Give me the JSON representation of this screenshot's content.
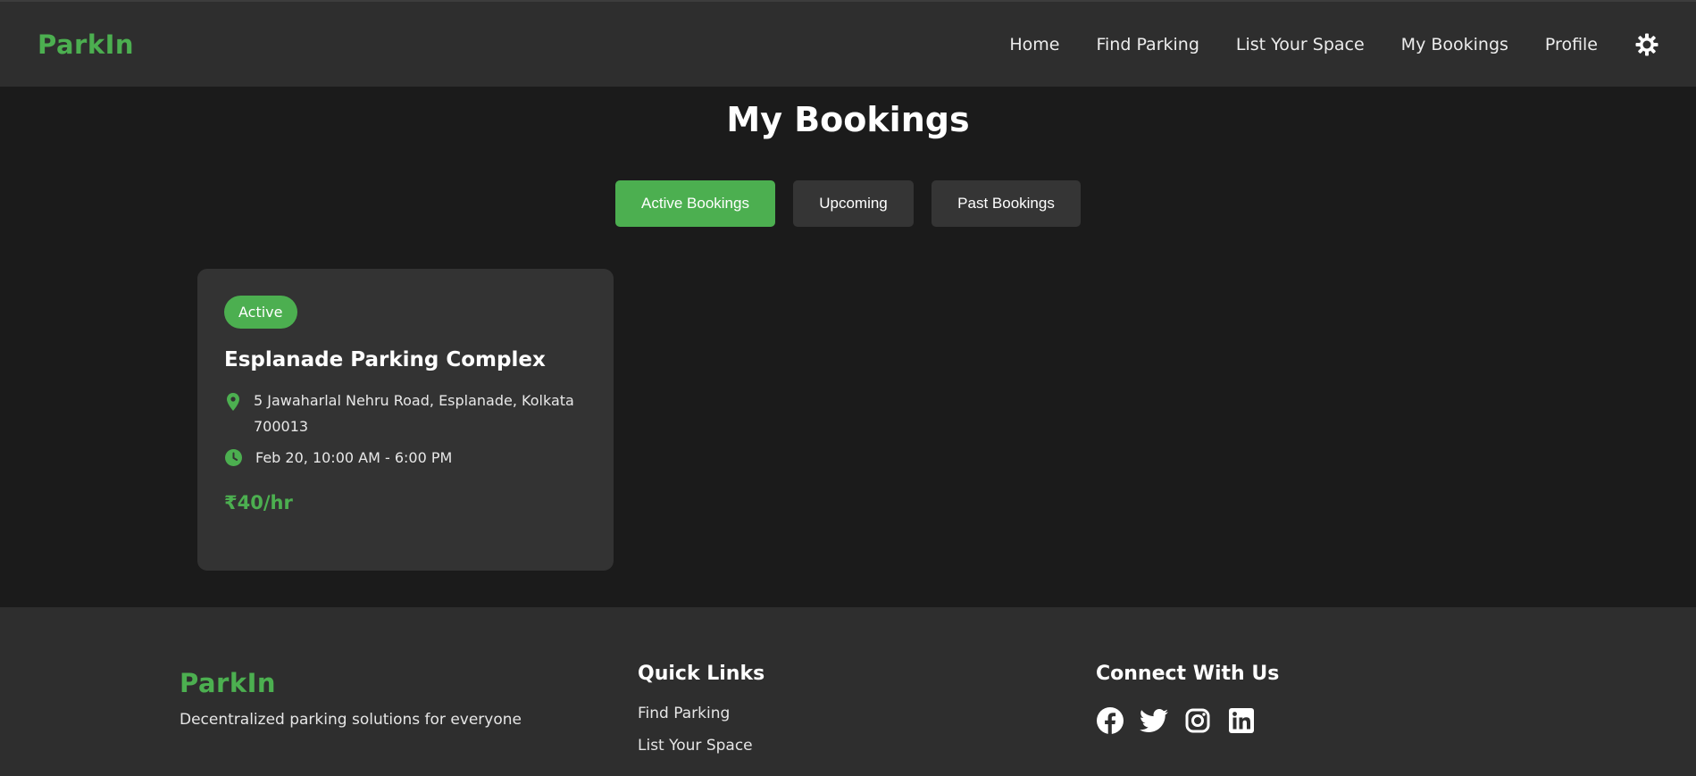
{
  "brand": {
    "name": "ParkIn",
    "accent": "#4caf50"
  },
  "nav": {
    "items": [
      {
        "label": "Home"
      },
      {
        "label": "Find Parking"
      },
      {
        "label": "List Your Space"
      },
      {
        "label": "My Bookings"
      },
      {
        "label": "Profile"
      }
    ],
    "theme_icon": "gear-sun-icon"
  },
  "page": {
    "title": "My Bookings"
  },
  "tabs": [
    {
      "label": "Active Bookings",
      "active": true
    },
    {
      "label": "Upcoming",
      "active": false
    },
    {
      "label": "Past Bookings",
      "active": false
    }
  ],
  "bookings": [
    {
      "status": "Active",
      "name": "Esplanade Parking Complex",
      "address": "5 Jawaharlal Nehru Road, Esplanade, Kolkata 700013",
      "time": "Feb 20, 10:00 AM - 6:00 PM",
      "price": "₹40/hr",
      "address_icon": "map-pin-icon",
      "time_icon": "clock-icon"
    }
  ],
  "footer": {
    "brand": "ParkIn",
    "tagline": "Decentralized parking solutions for everyone",
    "quick_links": {
      "heading": "Quick Links",
      "items": [
        "Find Parking",
        "List Your Space"
      ]
    },
    "connect": {
      "heading": "Connect With Us",
      "icons": [
        "facebook-icon",
        "twitter-icon",
        "instagram-icon",
        "linkedin-icon"
      ]
    }
  }
}
